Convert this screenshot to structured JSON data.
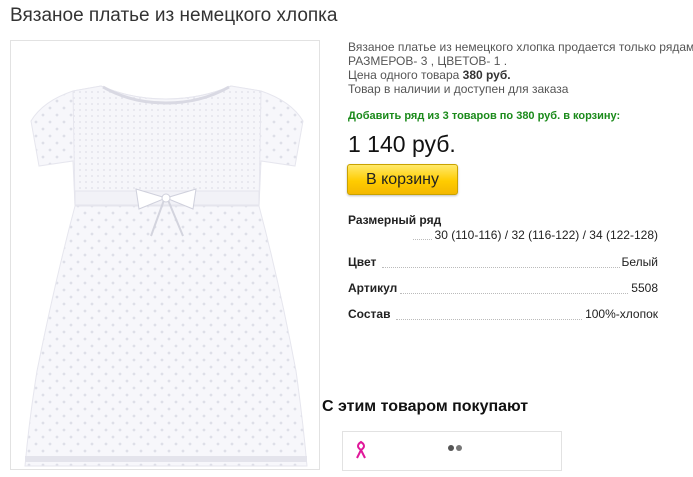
{
  "product": {
    "title": "Вязаное платье из немецкого хлопка",
    "description_line1": "Вязаное платье из немецкого хлопка продается только рядами:",
    "description_line2": "РАЗМЕРОВ- 3 , ЦВЕТОВ- 1 .",
    "unit_price_prefix": "Цена одного товара ",
    "unit_price_value": "380 руб.",
    "availability": "Товар в наличии и доступен для заказа",
    "add_row_text": "Добавить ряд из 3 товаров по 380 руб. в корзину:",
    "total_price": "1 140 руб.",
    "cart_button": "В корзину"
  },
  "specs": {
    "size_label": "Размерный ряд",
    "size_value": "30 (110-116) / 32 (116-122) / 34 (122-128)",
    "color_label": "Цвет",
    "color_value": "Белый",
    "article_label": "Артикул",
    "article_value": "5508",
    "composition_label": "Состав",
    "composition_value": "100%-хлопок"
  },
  "related": {
    "heading": "С этим товаром покупают"
  },
  "colors": {
    "cart_button": "#ffcc00",
    "add_row_text": "#1a8a1a",
    "related_icon": "#e0189a"
  },
  "icons": {
    "product_image": "white-knitted-dress",
    "related_item_icon": "pink-ribbon-icon"
  }
}
